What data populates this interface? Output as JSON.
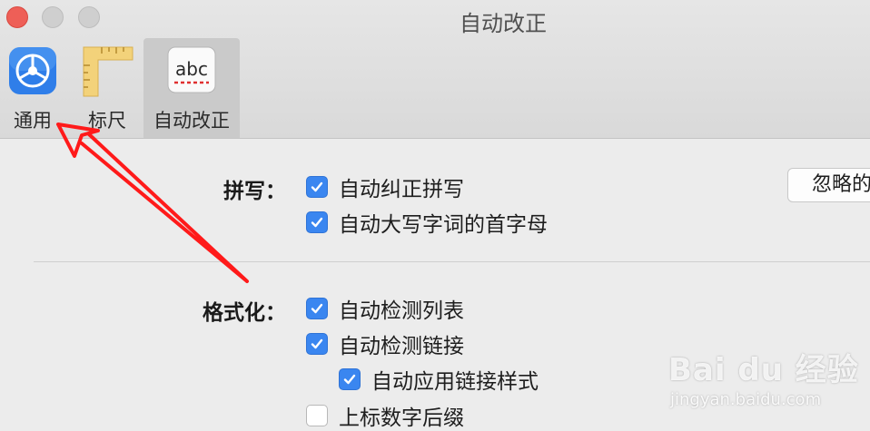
{
  "window": {
    "title": "自动改正"
  },
  "toolbar": {
    "tabs": [
      {
        "label": "通用",
        "icon": "gear-icon"
      },
      {
        "label": "标尺",
        "icon": "ruler-icon"
      },
      {
        "label": "自动改正",
        "icon": "abc-spellcheck-icon",
        "active": true
      }
    ]
  },
  "spelling": {
    "label": "拼写：",
    "options": [
      {
        "label": "自动纠正拼写",
        "checked": true
      },
      {
        "label": "自动大写字词的首字母",
        "checked": true
      }
    ],
    "ignore_button": "忽略的"
  },
  "formatting": {
    "label": "格式化：",
    "options": [
      {
        "label": "自动检测列表",
        "checked": true
      },
      {
        "label": "自动检测链接",
        "checked": true
      },
      {
        "label": "自动应用链接样式",
        "checked": true
      },
      {
        "label": "上标数字后缀",
        "checked": false
      }
    ]
  },
  "watermark": {
    "brand": "Bai du 经验",
    "url": "jingyan.baidu.com"
  },
  "colors": {
    "accent": "#3a86f0",
    "close": "#ee5f57",
    "annotation_arrow": "#ff1a1a"
  }
}
